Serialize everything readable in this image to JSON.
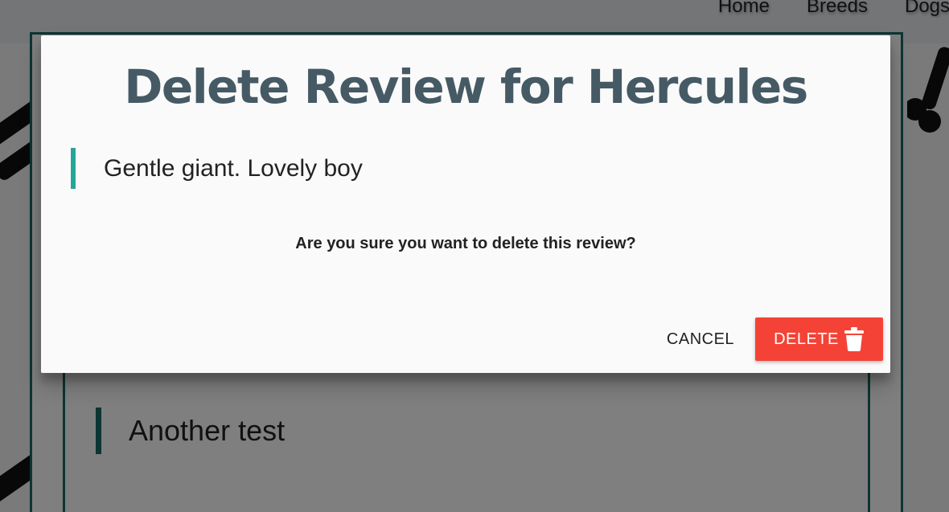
{
  "nav": {
    "links": [
      "Home",
      "Breeds",
      "Dogs"
    ]
  },
  "background": {
    "review_text": "Another test"
  },
  "modal": {
    "title": "Delete Review for Hercules",
    "review_text": "Gentle giant. Lovely boy",
    "confirm_text": "Are you sure you want to delete this review?",
    "cancel_label": "CANCEL",
    "delete_label": "DELETE",
    "delete_icon": "trash-icon"
  },
  "colors": {
    "accent_teal": "#26a69a",
    "dark_teal": "#1b6a66",
    "title_slate": "#455a64",
    "delete_red": "#f44336"
  }
}
